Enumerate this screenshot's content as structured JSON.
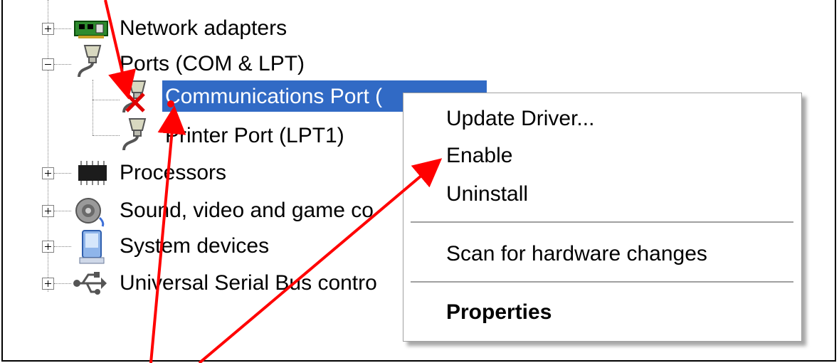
{
  "tree": {
    "network_adapters": "Network adapters",
    "ports": "Ports (COM & LPT)",
    "communications_port": "Communications Port (",
    "printer_port": "Printer Port (LPT1)",
    "processors": "Processors",
    "sound": "Sound, video and game co",
    "system_devices": "System devices",
    "usb": "Universal Serial Bus contro"
  },
  "context_menu": {
    "update_driver": "Update Driver...",
    "enable": "Enable",
    "uninstall": "Uninstall",
    "scan": "Scan for hardware changes",
    "properties": "Properties"
  },
  "colors": {
    "selection": "#316ac5",
    "annotation_arrow": "#ff0000"
  }
}
